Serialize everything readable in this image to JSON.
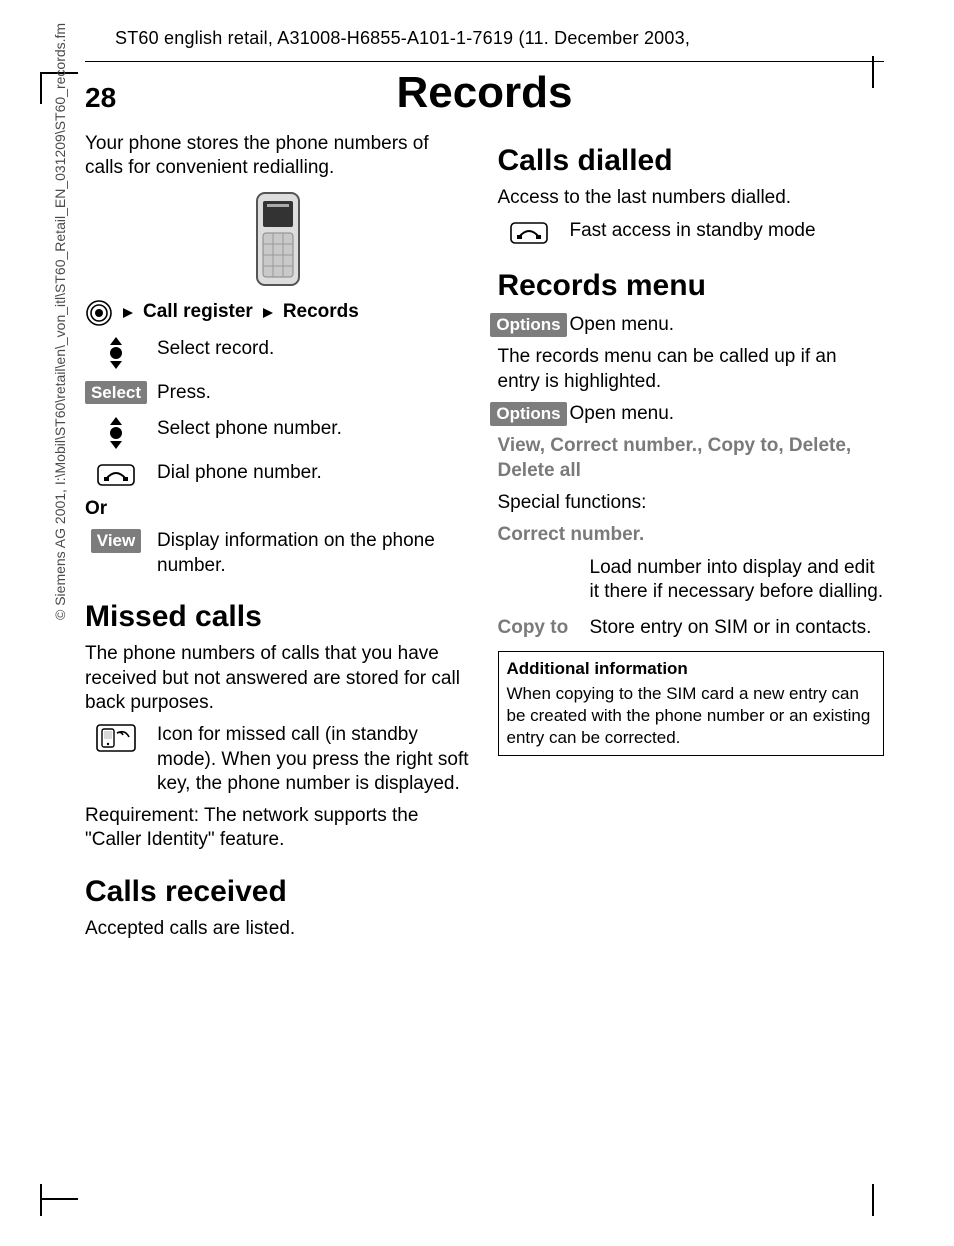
{
  "running_head": "ST60 english retail, A31008-H6855-A101-1-7619 (11. December 2003,",
  "page_number": "28",
  "page_title": "Records",
  "vertical_copyright": "© Siemens AG 2001, I:\\Mobil\\ST60\\retail\\en\\_von_itl\\ST60_Retail_EN_031209\\ST60_records.fm",
  "intro_para": "Your phone stores the phone numbers of calls for convenient redialling.",
  "nav_path": {
    "a": "Call register",
    "b": "Records"
  },
  "steps": {
    "select_record": "Select record.",
    "select_label": "Select",
    "press": "Press.",
    "select_phone_number": "Select phone number.",
    "dial_phone_number": "Dial phone number.",
    "or": "Or",
    "view_label": "View",
    "view_desc": "Display information on the phone number."
  },
  "missed": {
    "heading": "Missed calls",
    "para": "The phone numbers of calls that you have received but not answered are stored for call back purposes.",
    "icon_desc": "Icon for missed call (in standby mode). When you press the right soft key, the phone number is displayed.",
    "req": "Requirement: The network supports the \"Caller Identity\" feature."
  },
  "received": {
    "heading": "Calls received",
    "para": "Accepted calls are listed."
  },
  "dialled": {
    "heading": "Calls dialled",
    "para": "Access to the last numbers dialled.",
    "fast": "Fast access in standby mode"
  },
  "records_menu": {
    "heading": "Records menu",
    "options_label": "Options",
    "open_menu": "Open menu.",
    "para1": "The records menu can be called up if an entry is highlighted.",
    "grey_list": "View, Correct number., Copy to, Delete, Delete all",
    "special": "Special functions:",
    "correct_label": "Correct number.",
    "correct_desc": "Load number into display and edit it there if necessary before dialling.",
    "copyto_label": "Copy to",
    "copyto_desc": "Store entry on SIM or in contacts.",
    "box_title": "Additional information",
    "box_body": "When copying to the SIM card a new entry can be created with the phone number or an existing entry can be corrected."
  }
}
